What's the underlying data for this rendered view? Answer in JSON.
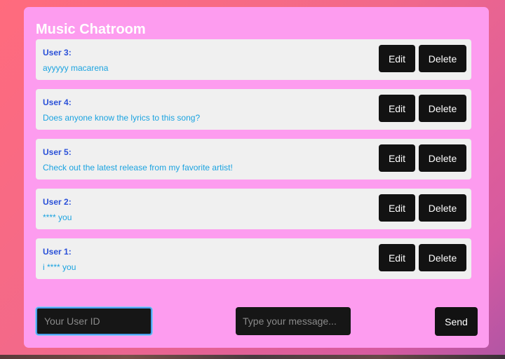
{
  "app": {
    "title": "Music Chatroom"
  },
  "messages": [
    {
      "user": "User 3:",
      "text": "ayyyyy macarena",
      "edit_label": "Edit",
      "delete_label": "Delete"
    },
    {
      "user": "User 4:",
      "text": "Does anyone know the lyrics to this song?",
      "edit_label": "Edit",
      "delete_label": "Delete"
    },
    {
      "user": "User 5:",
      "text": "Check out the latest release from my favorite artist!",
      "edit_label": "Edit",
      "delete_label": "Delete"
    },
    {
      "user": "User 2:",
      "text": "**** you",
      "edit_label": "Edit",
      "delete_label": "Delete"
    },
    {
      "user": "User 1:",
      "text": "i **** you",
      "edit_label": "Edit",
      "delete_label": "Delete"
    }
  ],
  "composer": {
    "user_id_placeholder": "Your User ID",
    "user_id_value": "",
    "message_placeholder": "Type your message...",
    "message_value": "",
    "send_label": "Send"
  },
  "colors": {
    "panel": "#fd9cef",
    "username": "#2a50d8",
    "message_text": "#1aa3e0",
    "button": "#121212"
  }
}
